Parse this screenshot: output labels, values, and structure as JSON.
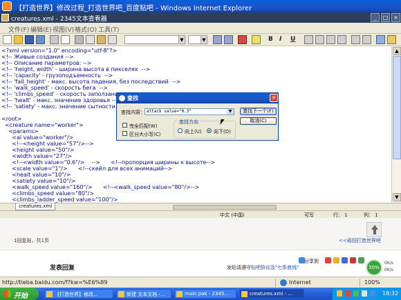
{
  "ie_window": {
    "title": "【打造世界】修改过程_打造世界吧_百度贴吧 - Windows Internet Explorer"
  },
  "editor_window": {
    "title": "creatures.xml - 2345文本查看器"
  },
  "menu": [
    "文件(F)",
    "编辑(E)",
    "视图(V)",
    "格式(O)",
    "工具(T)"
  ],
  "toolbar": {
    "bold_label": "B",
    "italic_label": "I",
    "underline_label": "U"
  },
  "editor": {
    "lines": [
      "<?xml version=\"1.0\" encoding=\"utf-8\"?>",
      "<!-- Живые создания -->",
      "<!-- Описание параметров: -->",
      "<!-- 'height, width' - ширина высота в пикселях  -->",
      "<!-- 'capacity' - грузоподъемность  -->",
      "<!-- 'fall_height' - макс. высота падения, без последствий  -->",
      "<!-- 'walk_speed' - скорость бега  -->",
      "<!-- 'climbs_speed' - скорость заползания -->",
      "<!-- 'healt' - макс. значение здоровья -->",
      "<!-- 'satiety' - макс. значение сытности  -->",
      "",
      "<root>",
      "  <creature name=\"worker\">",
      "    <params>",
      "      <ai value=\"worker\"/>",
      "      <!--<height value=\"57\"/>-->",
      "      <height value=\"50\"/>",
      "      <width value=\"27\"/>",
      "      <!--<width value=\"0.6\"/>    -->      <!--пропорция ширины к высоте-->",
      "      <scale value=\"1\"/>      <!--скейл для всех анимаций-->",
      "      <healt value=\"10\"/>",
      "      <satiety value=\"10\"/>",
      "      <walk_speed value=\"160\"/>      <!--<walk_speed value=\"80\"/>-->",
      "      <climbs_speed value=\"80\"/>",
      "      <climbs_ladder_speed value=\"100\"/>"
    ]
  },
  "tab": {
    "label": "creatures.xml"
  },
  "editor_status": {
    "encoding": "中文 (中国)",
    "writable": "可写",
    "line": "行： 1",
    "col": "列： 1"
  },
  "find_dialog": {
    "title": "查找",
    "find_label": "查找内容：",
    "find_value": "attack value=\"0.3\"",
    "find_next_label": "查找下一个(F)",
    "cancel_label": "取消(C)",
    "match_whole_label": "完全匹配(W)",
    "match_case_label": "区分大小写(C)",
    "direction_label": "查找方向",
    "up_label": "向上(U)",
    "down_label": "向下(D)",
    "direction_selected": "down"
  },
  "page": {
    "reply_count": "1",
    "reply_text": "回复贴，共1页",
    "back_link": "<<返回打造世界吧",
    "share_label": "分享到",
    "post_reply": "发表回复",
    "agree_prefix": "发贴请遵守",
    "agree_link": "贴吧协议及\"七条底线\"",
    "badge": "50%",
    "speed_up": "0K/s",
    "speed_down": "0K/s"
  },
  "ie_status": {
    "url": "http://tieba.baidu.com/f?kw=%E6%89",
    "zone": "Internet",
    "zoom": "100%"
  },
  "taskbar": {
    "start_label": "开始",
    "tasks": [
      "【打造世界】修改...",
      "新建 文本文档 -...",
      "main.pak - 2345...",
      "creatures.xml - ..."
    ],
    "clock": "18:32"
  }
}
